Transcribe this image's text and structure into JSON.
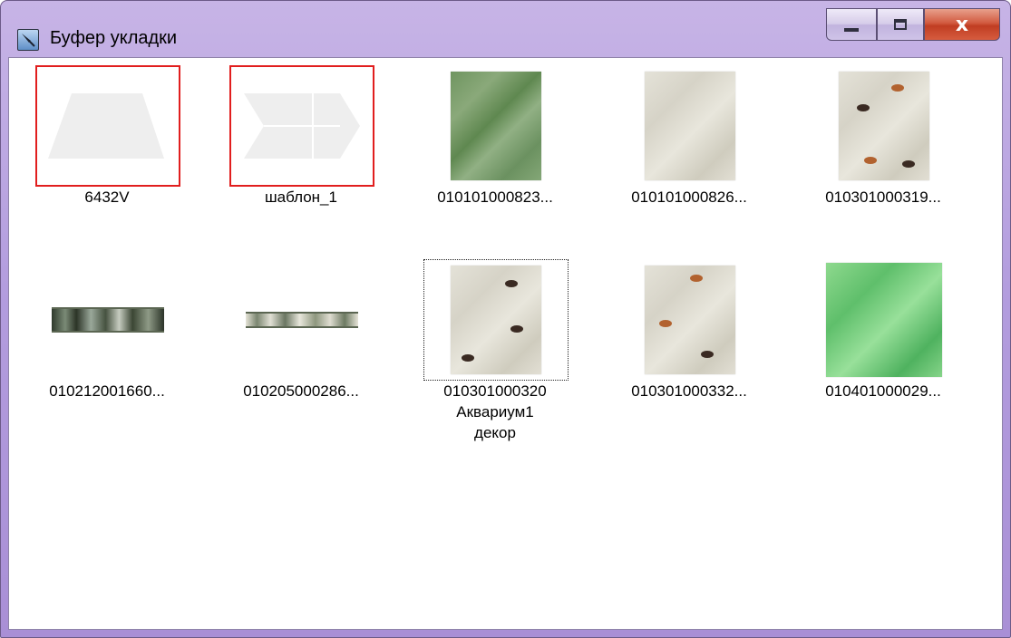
{
  "window": {
    "title": "Буфер укладки",
    "controls": {
      "minimize": "minimize",
      "maximize": "maximize",
      "close": "x"
    }
  },
  "items": [
    {
      "label": "6432V"
    },
    {
      "label": "шаблон_1"
    },
    {
      "label": "010101000823..."
    },
    {
      "label": "010101000826..."
    },
    {
      "label": "010301000319..."
    },
    {
      "label": "010212001660..."
    },
    {
      "label": "010205000286..."
    },
    {
      "label": "010301000320\nАквариум1\nдекор"
    },
    {
      "label": "010301000332..."
    },
    {
      "label": "010401000029..."
    }
  ],
  "colors": {
    "template_border": "#e11e1e",
    "titlebar": "#b39dde"
  }
}
